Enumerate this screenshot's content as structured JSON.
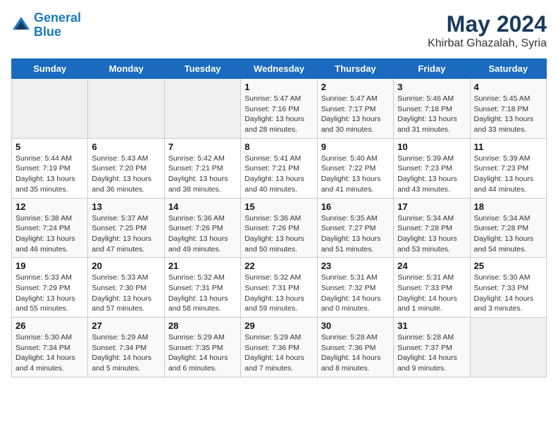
{
  "header": {
    "logo_line1": "General",
    "logo_line2": "Blue",
    "title": "May 2024",
    "subtitle": "Khirbat Ghazalah, Syria"
  },
  "days_of_week": [
    "Sunday",
    "Monday",
    "Tuesday",
    "Wednesday",
    "Thursday",
    "Friday",
    "Saturday"
  ],
  "weeks": [
    [
      {
        "day": "",
        "content": ""
      },
      {
        "day": "",
        "content": ""
      },
      {
        "day": "",
        "content": ""
      },
      {
        "day": "1",
        "content": "Sunrise: 5:47 AM\nSunset: 7:16 PM\nDaylight: 13 hours\nand 28 minutes."
      },
      {
        "day": "2",
        "content": "Sunrise: 5:47 AM\nSunset: 7:17 PM\nDaylight: 13 hours\nand 30 minutes."
      },
      {
        "day": "3",
        "content": "Sunrise: 5:46 AM\nSunset: 7:18 PM\nDaylight: 13 hours\nand 31 minutes."
      },
      {
        "day": "4",
        "content": "Sunrise: 5:45 AM\nSunset: 7:18 PM\nDaylight: 13 hours\nand 33 minutes."
      }
    ],
    [
      {
        "day": "5",
        "content": "Sunrise: 5:44 AM\nSunset: 7:19 PM\nDaylight: 13 hours\nand 35 minutes."
      },
      {
        "day": "6",
        "content": "Sunrise: 5:43 AM\nSunset: 7:20 PM\nDaylight: 13 hours\nand 36 minutes."
      },
      {
        "day": "7",
        "content": "Sunrise: 5:42 AM\nSunset: 7:21 PM\nDaylight: 13 hours\nand 38 minutes."
      },
      {
        "day": "8",
        "content": "Sunrise: 5:41 AM\nSunset: 7:21 PM\nDaylight: 13 hours\nand 40 minutes."
      },
      {
        "day": "9",
        "content": "Sunrise: 5:40 AM\nSunset: 7:22 PM\nDaylight: 13 hours\nand 41 minutes."
      },
      {
        "day": "10",
        "content": "Sunrise: 5:39 AM\nSunset: 7:23 PM\nDaylight: 13 hours\nand 43 minutes."
      },
      {
        "day": "11",
        "content": "Sunrise: 5:39 AM\nSunset: 7:23 PM\nDaylight: 13 hours\nand 44 minutes."
      }
    ],
    [
      {
        "day": "12",
        "content": "Sunrise: 5:38 AM\nSunset: 7:24 PM\nDaylight: 13 hours\nand 46 minutes."
      },
      {
        "day": "13",
        "content": "Sunrise: 5:37 AM\nSunset: 7:25 PM\nDaylight: 13 hours\nand 47 minutes."
      },
      {
        "day": "14",
        "content": "Sunrise: 5:36 AM\nSunset: 7:26 PM\nDaylight: 13 hours\nand 49 minutes."
      },
      {
        "day": "15",
        "content": "Sunrise: 5:36 AM\nSunset: 7:26 PM\nDaylight: 13 hours\nand 50 minutes."
      },
      {
        "day": "16",
        "content": "Sunrise: 5:35 AM\nSunset: 7:27 PM\nDaylight: 13 hours\nand 51 minutes."
      },
      {
        "day": "17",
        "content": "Sunrise: 5:34 AM\nSunset: 7:28 PM\nDaylight: 13 hours\nand 53 minutes."
      },
      {
        "day": "18",
        "content": "Sunrise: 5:34 AM\nSunset: 7:28 PM\nDaylight: 13 hours\nand 54 minutes."
      }
    ],
    [
      {
        "day": "19",
        "content": "Sunrise: 5:33 AM\nSunset: 7:29 PM\nDaylight: 13 hours\nand 55 minutes."
      },
      {
        "day": "20",
        "content": "Sunrise: 5:33 AM\nSunset: 7:30 PM\nDaylight: 13 hours\nand 57 minutes."
      },
      {
        "day": "21",
        "content": "Sunrise: 5:32 AM\nSunset: 7:31 PM\nDaylight: 13 hours\nand 58 minutes."
      },
      {
        "day": "22",
        "content": "Sunrise: 5:32 AM\nSunset: 7:31 PM\nDaylight: 13 hours\nand 59 minutes."
      },
      {
        "day": "23",
        "content": "Sunrise: 5:31 AM\nSunset: 7:32 PM\nDaylight: 14 hours\nand 0 minutes."
      },
      {
        "day": "24",
        "content": "Sunrise: 5:31 AM\nSunset: 7:33 PM\nDaylight: 14 hours\nand 1 minute."
      },
      {
        "day": "25",
        "content": "Sunrise: 5:30 AM\nSunset: 7:33 PM\nDaylight: 14 hours\nand 3 minutes."
      }
    ],
    [
      {
        "day": "26",
        "content": "Sunrise: 5:30 AM\nSunset: 7:34 PM\nDaylight: 14 hours\nand 4 minutes."
      },
      {
        "day": "27",
        "content": "Sunrise: 5:29 AM\nSunset: 7:34 PM\nDaylight: 14 hours\nand 5 minutes."
      },
      {
        "day": "28",
        "content": "Sunrise: 5:29 AM\nSunset: 7:35 PM\nDaylight: 14 hours\nand 6 minutes."
      },
      {
        "day": "29",
        "content": "Sunrise: 5:29 AM\nSunset: 7:36 PM\nDaylight: 14 hours\nand 7 minutes."
      },
      {
        "day": "30",
        "content": "Sunrise: 5:28 AM\nSunset: 7:36 PM\nDaylight: 14 hours\nand 8 minutes."
      },
      {
        "day": "31",
        "content": "Sunrise: 5:28 AM\nSunset: 7:37 PM\nDaylight: 14 hours\nand 9 minutes."
      },
      {
        "day": "",
        "content": ""
      }
    ]
  ]
}
